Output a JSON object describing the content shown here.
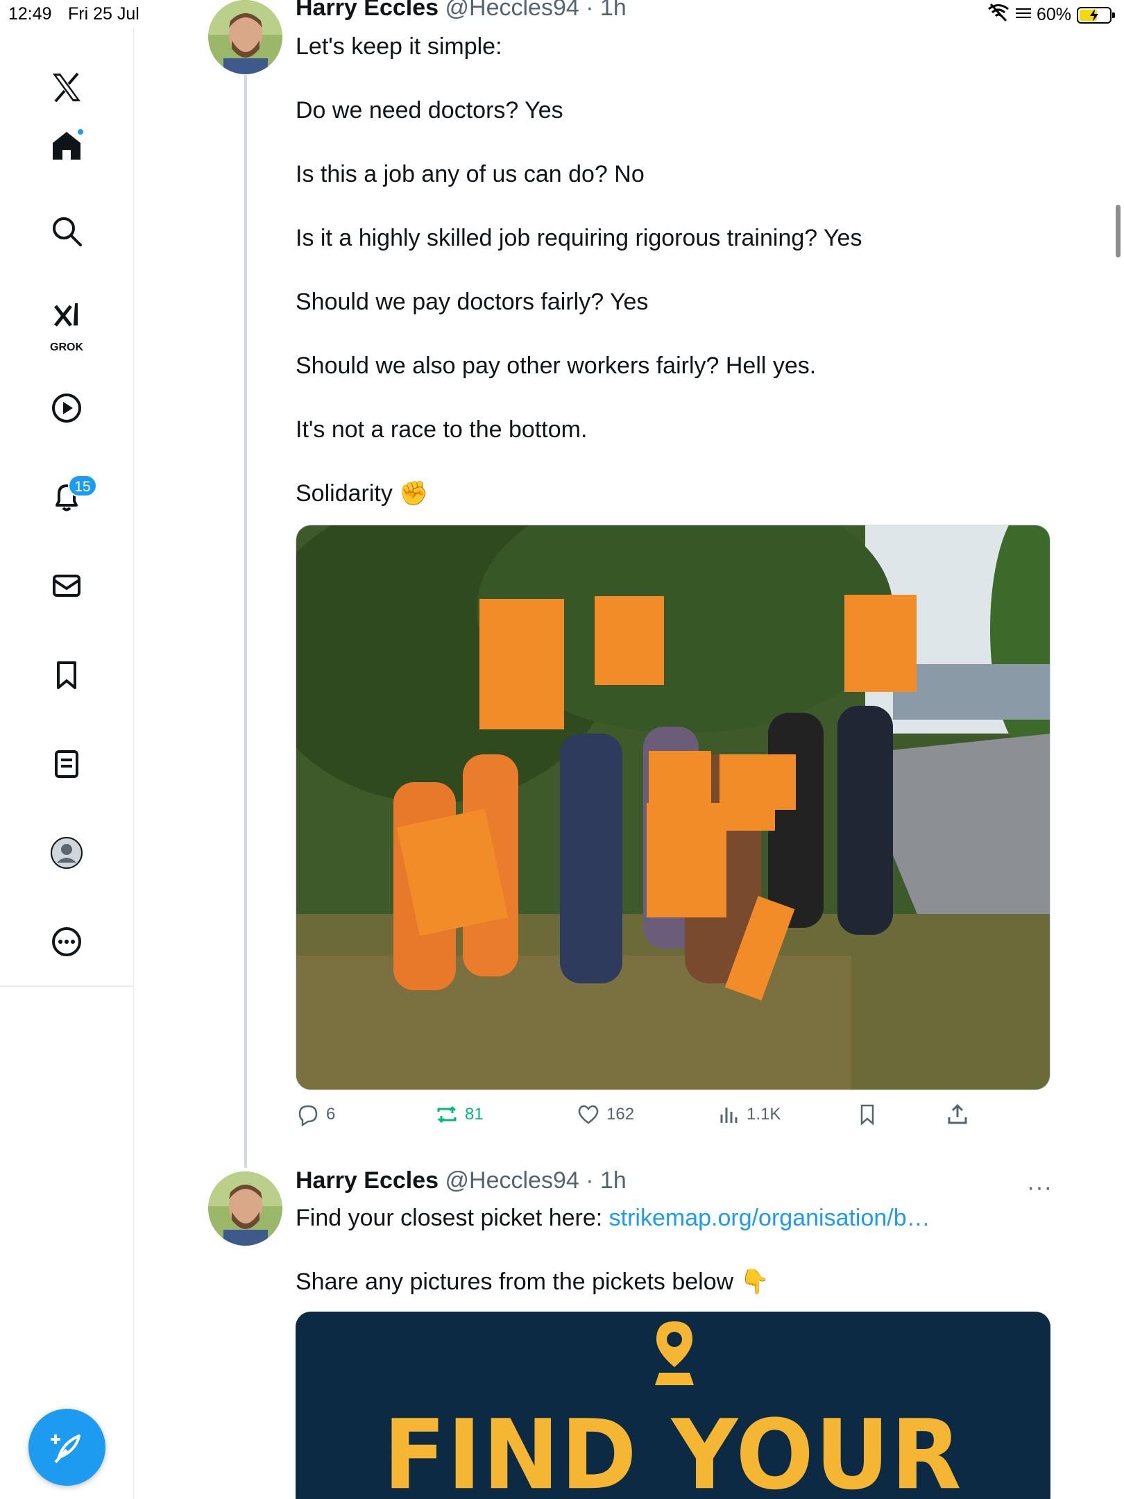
{
  "status_bar": {
    "time": "12:49",
    "date": "Fri 25 Jul",
    "battery_percent": "60%",
    "battery_level": 0.6
  },
  "sidebar": {
    "grok_label": "GROK",
    "notifications_count": "15",
    "items": [
      "x-logo",
      "home-icon",
      "search-icon",
      "grok-icon",
      "video-icon",
      "bell-icon",
      "mail-icon",
      "bookmark-icon",
      "list-icon",
      "profile-icon",
      "more-icon"
    ]
  },
  "tweet1": {
    "name": "Harry Eccles",
    "handle": "@Heccles94",
    "time": "· 1h",
    "lines": [
      "Let's keep it simple:",
      "",
      "Do we need doctors? Yes",
      "",
      "Is this a job any of us can do? No",
      "",
      "Is it a highly skilled job requiring rigorous training? Yes",
      "",
      "Should we pay doctors fairly? Yes",
      "",
      "Should we also pay other workers fairly? Hell yes.",
      "",
      "It's not a race to the bottom.",
      "",
      "Solidarity ✊"
    ],
    "actions": {
      "replies": "6",
      "reposts": "81",
      "likes": "162",
      "views": "1.1K"
    }
  },
  "tweet2": {
    "name": "Harry Eccles",
    "handle": "@Heccles94",
    "time": "· 1h",
    "more": "···",
    "text_prefix": "Find your closest picket here: ",
    "link": "strikemap.org/organisation/b…",
    "line2": "Share any pictures from the pickets below 👇",
    "card_title": "FIND YOUR"
  },
  "colors": {
    "accent": "#1d9bf0",
    "repost": "#00ba7c",
    "muted": "#536471",
    "card_bg": "#0c2a44",
    "card_text": "#f5b733",
    "placard_orange": "#f28c28"
  }
}
